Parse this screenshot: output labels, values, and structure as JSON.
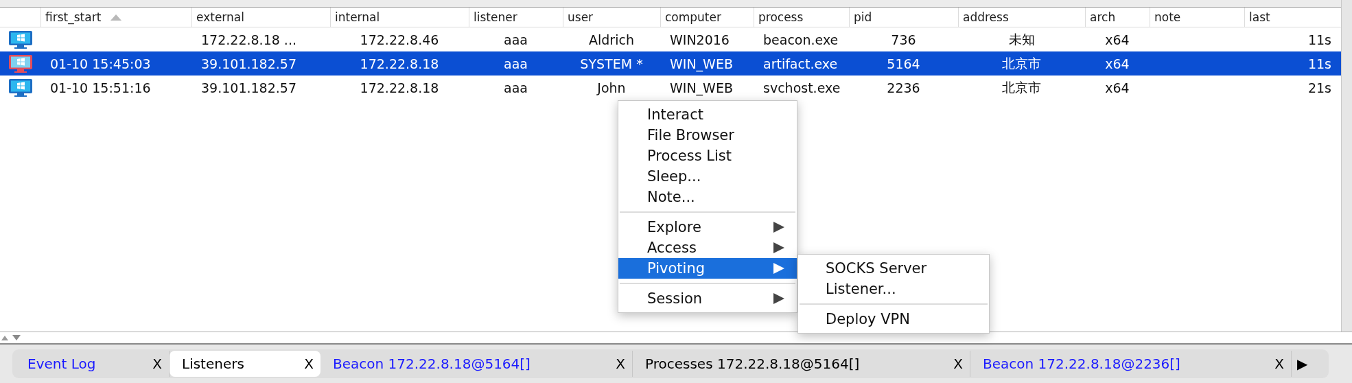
{
  "table": {
    "columns": [
      {
        "label": "first_start",
        "sorted": true
      },
      {
        "label": "external",
        "sorted": false
      },
      {
        "label": "internal",
        "sorted": false
      },
      {
        "label": "listener",
        "sorted": false
      },
      {
        "label": "user",
        "sorted": false
      },
      {
        "label": "computer",
        "sorted": false
      },
      {
        "label": "process",
        "sorted": false
      },
      {
        "label": "pid",
        "sorted": false
      },
      {
        "label": "address",
        "sorted": false
      },
      {
        "label": "arch",
        "sorted": false
      },
      {
        "label": "note",
        "sorted": false
      },
      {
        "label": "last",
        "sorted": false
      }
    ],
    "rows": [
      {
        "selected": false,
        "elevated": false,
        "cells": [
          null,
          "172.22.8.18 ...",
          "172.22.8.46",
          "aaa",
          "Aldrich",
          "WIN2016",
          "beacon.exe",
          "736",
          "未知",
          "x64",
          null,
          "11s"
        ]
      },
      {
        "selected": true,
        "elevated": true,
        "cells": [
          "01-10 15:45:03",
          "39.101.182.57",
          "172.22.8.18",
          "aaa",
          "SYSTEM *",
          "WIN_WEB",
          "artifact.exe",
          "5164",
          "北京市",
          "x64",
          null,
          "11s"
        ]
      },
      {
        "selected": false,
        "elevated": false,
        "cells": [
          "01-10 15:51:16",
          "39.101.182.57",
          "172.22.8.18",
          "aaa",
          "John",
          "WIN_WEB",
          "svchost.exe",
          "2236",
          "北京市",
          "x64",
          null,
          "21s"
        ]
      }
    ]
  },
  "context_menu": {
    "items": [
      {
        "kind": "item",
        "label": "Interact",
        "selected": false
      },
      {
        "kind": "item",
        "label": "File Browser",
        "selected": false
      },
      {
        "kind": "item",
        "label": "Process List",
        "selected": false
      },
      {
        "kind": "item",
        "label": "Sleep...",
        "selected": false
      },
      {
        "kind": "item",
        "label": "Note...",
        "selected": false
      },
      {
        "kind": "separator"
      },
      {
        "kind": "submenu",
        "label": "Explore",
        "selected": false
      },
      {
        "kind": "submenu",
        "label": "Access",
        "selected": false
      },
      {
        "kind": "submenu",
        "label": "Pivoting",
        "selected": true,
        "children": [
          {
            "kind": "item",
            "label": "SOCKS Server",
            "selected": false
          },
          {
            "kind": "item",
            "label": "Listener...",
            "selected": false
          },
          {
            "kind": "separator"
          },
          {
            "kind": "item",
            "label": "Deploy VPN",
            "selected": false
          }
        ]
      },
      {
        "kind": "separator"
      },
      {
        "kind": "submenu",
        "label": "Session",
        "selected": false
      }
    ]
  },
  "tabs": [
    {
      "label": "Event Log",
      "close": "X",
      "selected": false,
      "color": "#1a1aff"
    },
    {
      "label": "Listeners",
      "close": "X",
      "selected": true,
      "color": "#000000"
    },
    {
      "label": "Beacon 172.22.8.18@5164[]",
      "close": "X",
      "selected": false,
      "color": "#1a1aff"
    },
    {
      "label": "Processes 172.22.8.18@5164[]",
      "close": "X",
      "selected": false,
      "color": "#000000"
    },
    {
      "label": "Beacon 172.22.8.18@2236[]",
      "close": "X",
      "selected": false,
      "color": "#1a1aff"
    }
  ],
  "tab_overflow": "▶"
}
